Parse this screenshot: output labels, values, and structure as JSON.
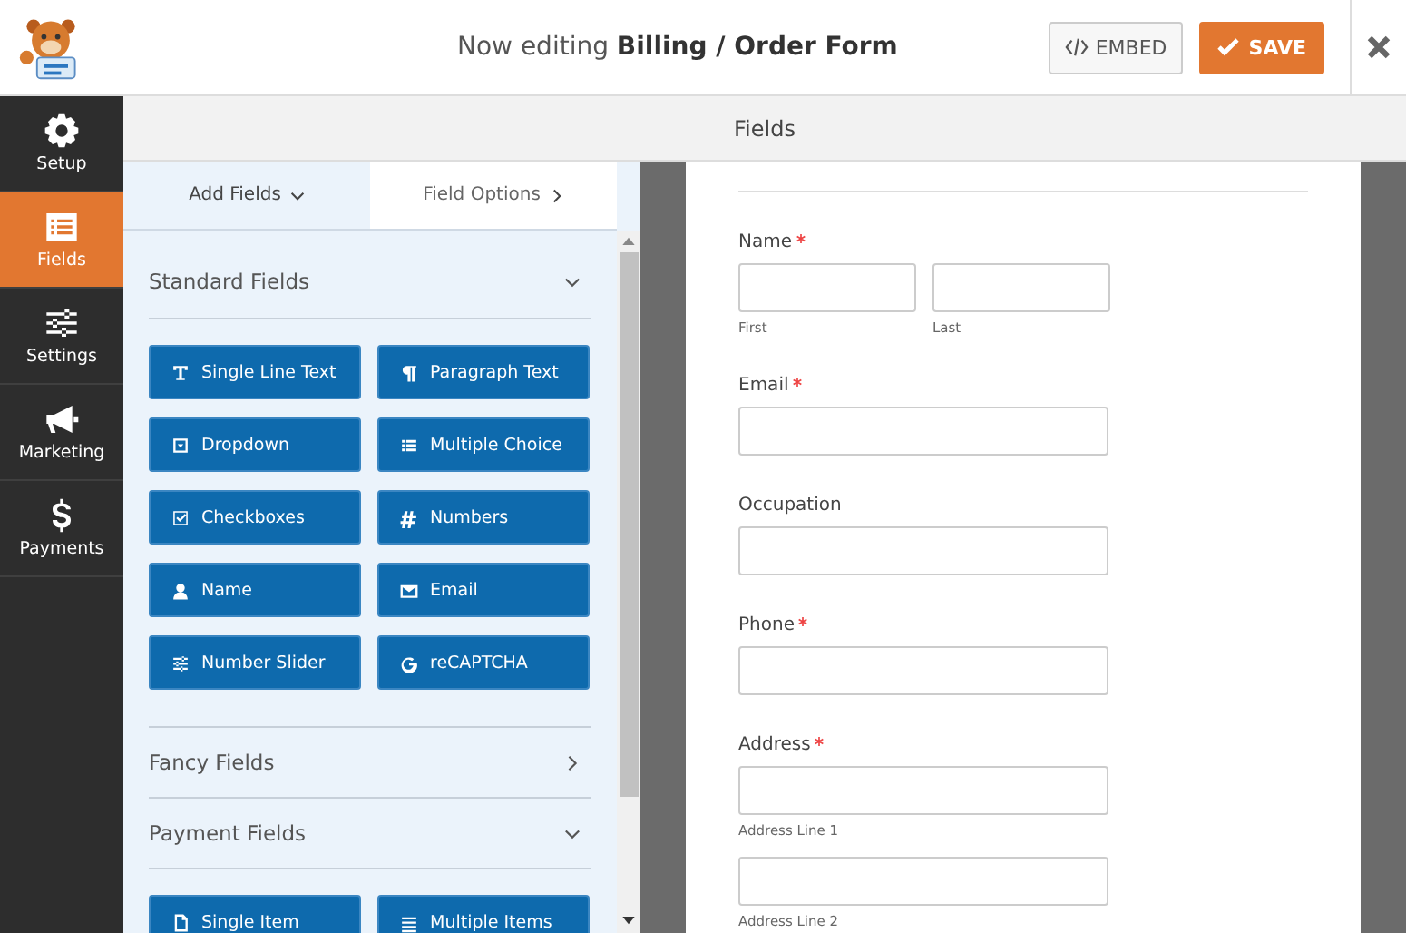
{
  "header": {
    "title_prefix": "Now editing",
    "title_form": "Billing / Order Form",
    "embed_button": "EMBED",
    "save_button": "SAVE"
  },
  "nav": [
    {
      "label": "Setup",
      "selected": false
    },
    {
      "label": "Fields",
      "selected": true
    },
    {
      "label": "Settings",
      "selected": false
    },
    {
      "label": "Marketing",
      "selected": false
    },
    {
      "label": "Payments",
      "selected": false
    }
  ],
  "section_title": "Fields",
  "tabs": [
    {
      "label": "Add Fields",
      "selected": true
    },
    {
      "label": "Field Options",
      "selected": false
    }
  ],
  "groups": [
    {
      "title": "Standard Fields",
      "expanded": true,
      "buttons": [
        "Single Line Text",
        "Paragraph Text",
        "Dropdown",
        "Multiple Choice",
        "Checkboxes",
        "Numbers",
        "Name",
        "Email",
        "Number Slider",
        "reCAPTCHA"
      ]
    },
    {
      "title": "Fancy Fields",
      "expanded": false
    },
    {
      "title": "Payment Fields",
      "expanded": true,
      "buttons": [
        "Single Item",
        "Multiple Items"
      ]
    }
  ],
  "form_fields": [
    {
      "kind": "name",
      "label": "Name",
      "required": true,
      "sublabels": [
        "First",
        "Last"
      ]
    },
    {
      "kind": "text",
      "label": "Email",
      "required": true
    },
    {
      "kind": "text",
      "label": "Occupation",
      "required": false
    },
    {
      "kind": "text",
      "label": "Phone",
      "required": true
    },
    {
      "kind": "address",
      "label": "Address",
      "required": true,
      "sublabels": [
        "Address Line 1",
        "Address Line 2"
      ]
    }
  ]
}
